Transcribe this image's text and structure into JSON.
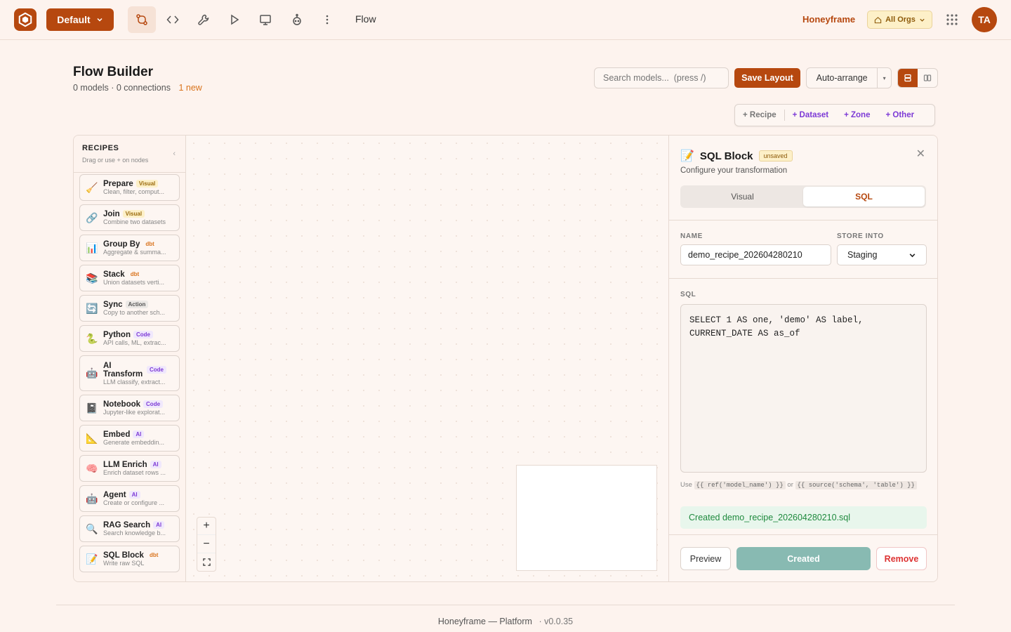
{
  "topbar": {
    "workspace_button": "Default",
    "breadcrumb": "Flow",
    "org_name": "Honeyframe",
    "org_switcher": "All Orgs",
    "avatar_initials": "TA",
    "tools": [
      "flow-icon",
      "code-icon",
      "wrench-icon",
      "play-icon",
      "monitor-icon",
      "bot-icon",
      "more-vertical-icon"
    ],
    "accent_color": "#b6480f"
  },
  "header": {
    "title": "Flow Builder",
    "models_count": "0 models · 0 connections",
    "new_badge": "1 new",
    "search_placeholder": "Search models...  (press /)",
    "save_layout": "Save Layout",
    "auto_arrange": "Auto-arrange"
  },
  "add_bar": {
    "recipe": "+ Recipe",
    "dataset": "+ Dataset",
    "zone": "+ Zone",
    "other": "+ Other"
  },
  "sidebar": {
    "title": "RECIPES",
    "subtitle": "Drag or use + on nodes",
    "items": [
      {
        "icon": "🧹",
        "name": "Prepare",
        "tag": "Visual",
        "tag_type": "visual",
        "desc": "Clean, filter, comput..."
      },
      {
        "icon": "🔗",
        "name": "Join",
        "tag": "Visual",
        "tag_type": "visual",
        "desc": "Combine two datasets"
      },
      {
        "icon": "📊",
        "name": "Group By",
        "tag": "dbt",
        "tag_type": "dbt",
        "desc": "Aggregate & summa..."
      },
      {
        "icon": "📚",
        "name": "Stack",
        "tag": "dbt",
        "tag_type": "dbt",
        "desc": "Union datasets verti..."
      },
      {
        "icon": "🔄",
        "name": "Sync",
        "tag": "Action",
        "tag_type": "action",
        "desc": "Copy to another sch..."
      },
      {
        "icon": "🐍",
        "name": "Python",
        "tag": "Code",
        "tag_type": "code",
        "desc": "API calls, ML, extrac..."
      },
      {
        "icon": "🤖",
        "name": "AI Transform",
        "tag": "Code",
        "tag_type": "code",
        "desc": "LLM classify, extract..."
      },
      {
        "icon": "📓",
        "name": "Notebook",
        "tag": "Code",
        "tag_type": "code",
        "desc": "Jupyter-like explorat..."
      },
      {
        "icon": "📐",
        "name": "Embed",
        "tag": "AI",
        "tag_type": "ai",
        "desc": "Generate embeddin..."
      },
      {
        "icon": "🧠",
        "name": "LLM Enrich",
        "tag": "AI",
        "tag_type": "ai",
        "desc": "Enrich dataset rows ..."
      },
      {
        "icon": "🤖",
        "name": "Agent",
        "tag": "AI",
        "tag_type": "ai",
        "desc": "Create or configure ..."
      },
      {
        "icon": "🔍",
        "name": "RAG Search",
        "tag": "AI",
        "tag_type": "ai",
        "desc": "Search knowledge b..."
      },
      {
        "icon": "📝",
        "name": "SQL Block",
        "tag": "dbt",
        "tag_type": "dbt",
        "desc": "Write raw SQL"
      }
    ]
  },
  "panel": {
    "icon": "📝",
    "title": "SQL Block",
    "status": "unsaved",
    "subtitle": "Configure your transformation",
    "tabs": [
      "Visual",
      "SQL"
    ],
    "active_tab": "SQL",
    "name_label": "NAME",
    "name_value": "demo_recipe_202604280210",
    "store_label": "STORE INTO",
    "store_value": "Staging",
    "sql_label": "SQL",
    "sql_text": "SELECT 1 AS one, 'demo' AS label,\nCURRENT_DATE AS as_of",
    "hint_use": "Use",
    "hint_ref": "{{ ref('model_name') }}",
    "hint_or": "or",
    "hint_source": "{{ source('schema', 'table') }}",
    "success_message": "Created demo_recipe_202604280210.sql",
    "preview_button": "Preview",
    "created_button": "Created",
    "remove_button": "Remove"
  },
  "footer": {
    "text": "Honeyframe — Platform",
    "version": "· v0.0.35"
  }
}
